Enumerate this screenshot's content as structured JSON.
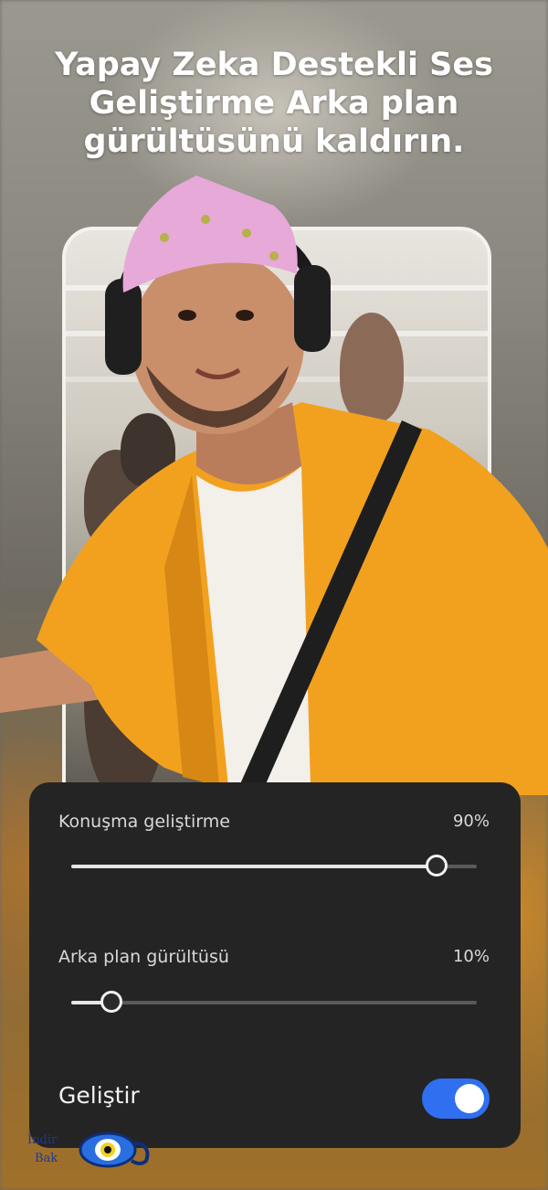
{
  "headline": "Yapay Zeka Destekli Ses Geliştirme Arka plan gürültüsünü kaldırın.",
  "controls": {
    "speech": {
      "label": "Konuşma geliştirme",
      "value_text": "90%",
      "value": 0.9
    },
    "noise": {
      "label": "Arka plan gürültüsü",
      "value_text": "10%",
      "value": 0.1
    },
    "enhance": {
      "label": "Geliştir",
      "on": true
    }
  },
  "watermark": {
    "line1": "İndir",
    "line2": "Bak"
  },
  "colors": {
    "panel": "#242424",
    "toggle_on": "#2f6ff0",
    "shirt": "#f2a11f",
    "bandana": "#e6a9d8"
  },
  "icons": {
    "watermark_logo": "eye-logo-icon"
  }
}
